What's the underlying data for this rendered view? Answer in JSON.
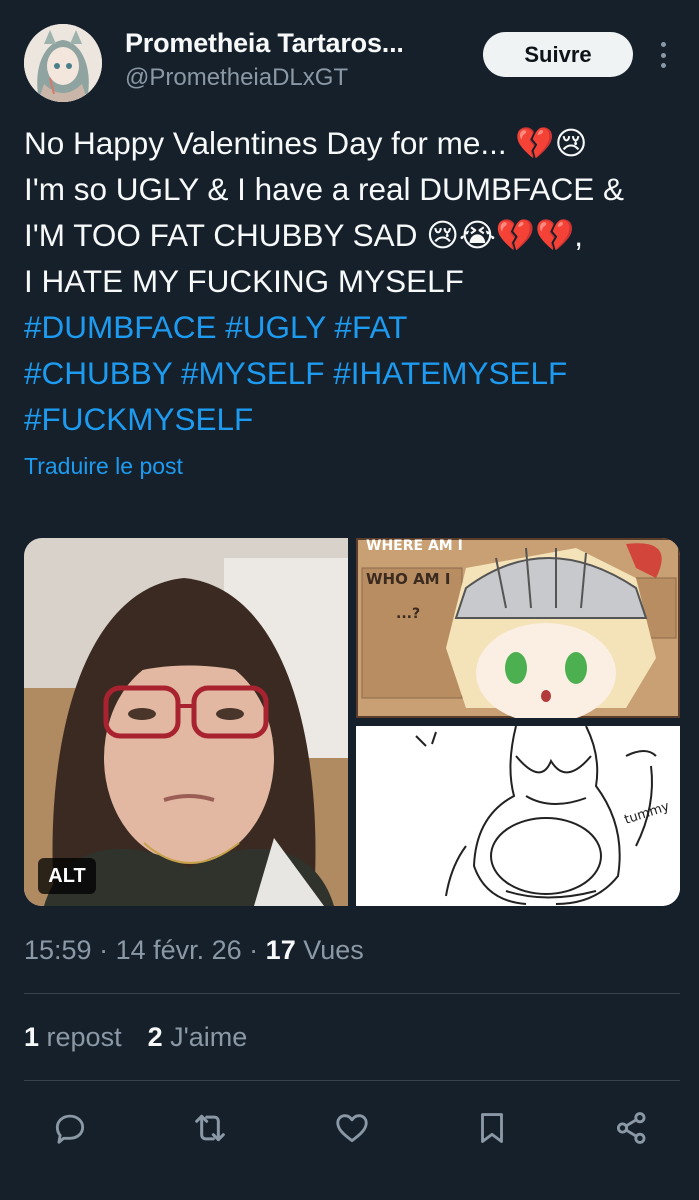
{
  "author": {
    "display_name": "Prometheia Tartaros...",
    "handle": "@PrometheiaDLxGT"
  },
  "follow_label": "Suivre",
  "tweet": {
    "lines": [
      "No Happy Valentines Day for me... 💔😢",
      "I'm so UGLY & I have a real DUMBFACE &",
      "I'M TOO FAT CHUBBY SAD 😢😭💔💔,",
      "I HATE MY FUCKING MYSELF"
    ],
    "hashtag_lines": [
      "#DUMBFACE #UGLY #FAT",
      "#CHUBBY #MYSELF #IHATEMYSELF",
      "#FUCKMYSELF"
    ]
  },
  "translate_label": "Traduire le post",
  "media": {
    "alt_label": "ALT",
    "comic_text_top": "WHERE AM I",
    "comic_text_mid": "WHO AM I",
    "comic_text_low": "...?",
    "sketch_text": "tummy"
  },
  "meta": {
    "time": "15:59",
    "separator": " · ",
    "date": "14 févr. 26",
    "views_count": "17",
    "views_label": " Vues"
  },
  "stats": {
    "reposts_count": "1",
    "reposts_label": " repost",
    "likes_count": "2",
    "likes_label": " J'aime"
  },
  "icons": {
    "reply": "reply-icon",
    "repost": "repost-icon",
    "like": "heart-icon",
    "bookmark": "bookmark-icon",
    "share": "share-icon",
    "more": "more-vertical-icon"
  },
  "colors": {
    "background": "#15202b",
    "accent": "#1d9bf0",
    "muted": "#8b98a5",
    "text": "#f7f9f9"
  }
}
